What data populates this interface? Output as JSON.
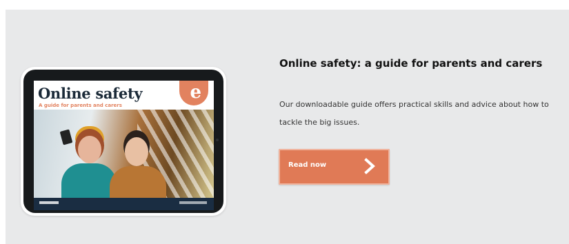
{
  "promo": {
    "title": "Online safety: a guide for parents and carers",
    "description": "Our downloadable guide offers practical skills and advice about how to tackle the big issues.",
    "button_label": "Read now",
    "button_icon": "chevron-right-icon"
  },
  "cover": {
    "title": "Online safety",
    "subtitle": "A guide for parents and carers",
    "badge_glyph": "e"
  },
  "colors": {
    "card_bg": "#e8e9ea",
    "accent": "#e07a56",
    "tablet_frame": "#171a1c",
    "cover_footer": "#1a2d42"
  }
}
